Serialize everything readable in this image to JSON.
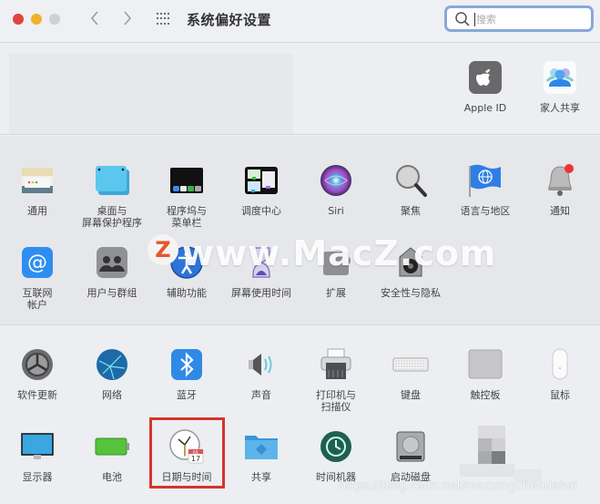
{
  "window": {
    "title": "系统偏好设置",
    "traffic_lights": {
      "close": "#e0443e",
      "minimize": "#f0b22b",
      "zoom": "#cfd0d2"
    },
    "nav": {
      "back_icon": "chevron-left-icon",
      "forward_icon": "chevron-right-icon",
      "show_all_icon": "grid-icon"
    },
    "search": {
      "placeholder": "搜索",
      "value": ""
    }
  },
  "account_section": {
    "items": [
      {
        "label": "Apple ID",
        "icon": "apple-id-icon"
      },
      {
        "label": "家人共享",
        "icon": "family-sharing-icon"
      }
    ]
  },
  "personal_section": {
    "row1": [
      {
        "label": "通用",
        "icon": "general-icon"
      },
      {
        "label": "桌面与\n屏幕保护程序",
        "line1": "桌面与",
        "line2": "屏幕保护程序",
        "icon": "desktop-icon"
      },
      {
        "label": "程序坞与\n菜单栏",
        "line1": "程序坞与",
        "line2": "菜单栏",
        "icon": "dock-icon"
      },
      {
        "label": "调度中心",
        "icon": "mission-control-icon"
      },
      {
        "label": "Siri",
        "icon": "siri-icon"
      },
      {
        "label": "聚焦",
        "icon": "spotlight-icon"
      },
      {
        "label": "语言与地区",
        "icon": "language-region-icon"
      },
      {
        "label": "通知",
        "icon": "notifications-icon"
      }
    ],
    "row2": [
      {
        "label": "互联网\n帐户",
        "line1": "互联网",
        "line2": "帐户",
        "icon": "internet-accounts-icon"
      },
      {
        "label": "用户与群组",
        "icon": "users-groups-icon"
      },
      {
        "label": "辅助功能",
        "icon": "accessibility-icon"
      },
      {
        "label": "屏幕使用时间",
        "icon": "screen-time-icon"
      },
      {
        "label": "扩展",
        "icon": "extensions-icon"
      },
      {
        "label": "安全性与隐私",
        "icon": "security-privacy-icon"
      }
    ]
  },
  "hardware_section": {
    "row1": [
      {
        "label": "软件更新",
        "icon": "software-update-icon"
      },
      {
        "label": "网络",
        "icon": "network-icon"
      },
      {
        "label": "蓝牙",
        "icon": "bluetooth-icon"
      },
      {
        "label": "声音",
        "icon": "sound-icon"
      },
      {
        "label": "打印机与\n扫描仪",
        "line1": "打印机与",
        "line2": "扫描仪",
        "icon": "printer-icon"
      },
      {
        "label": "键盘",
        "icon": "keyboard-icon"
      },
      {
        "label": "触控板",
        "icon": "trackpad-icon"
      },
      {
        "label": "鼠标",
        "icon": "mouse-icon"
      }
    ],
    "row2": [
      {
        "label": "显示器",
        "icon": "displays-icon"
      },
      {
        "label": "电池",
        "icon": "battery-icon"
      },
      {
        "label": "日期与时间",
        "icon": "date-time-icon",
        "highlighted": true,
        "calendar_month": "JUL",
        "calendar_day": "17"
      },
      {
        "label": "共享",
        "icon": "sharing-icon"
      },
      {
        "label": "时间机器",
        "icon": "time-machine-icon"
      },
      {
        "label": "启动磁盘",
        "icon": "startup-disk-icon"
      }
    ]
  },
  "highlight_color": "#d6352b",
  "watermarks": {
    "macz": "www.MacZ.com",
    "macz_logo": "Z",
    "csdn": "https://blog.csdn.net/macxingchendahai"
  }
}
